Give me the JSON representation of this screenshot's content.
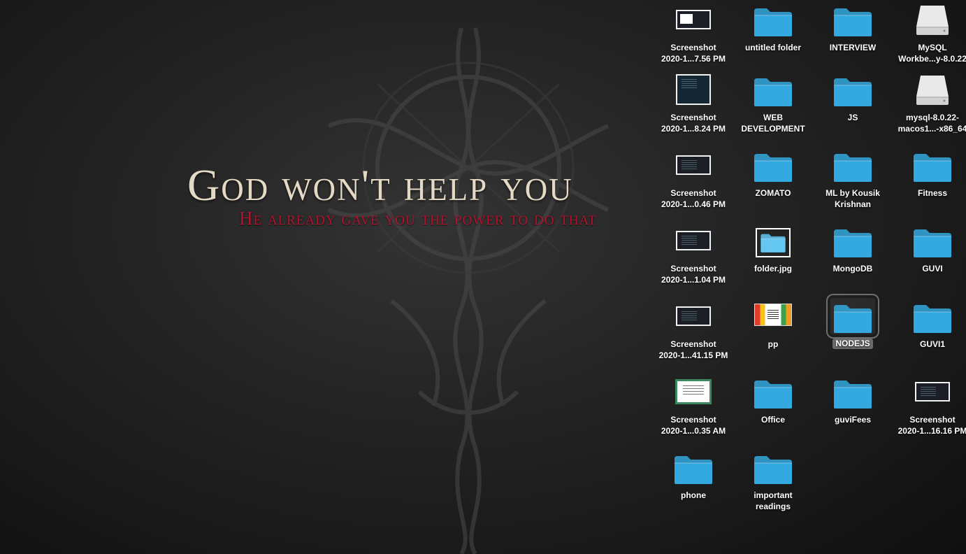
{
  "wallpaper": {
    "title": "God won't help you",
    "subtitle": "He already gave you the power to do that",
    "colors": {
      "title": "#e4d9c4",
      "subtitle": "#b3132e",
      "background": "#1e1e1e"
    }
  },
  "colors": {
    "folder": "#34a9e0",
    "folder_light": "#63c7f2",
    "selection": "#6b6b6b"
  },
  "icons": [
    {
      "name": "screenshot-1",
      "type": "screenshot",
      "variant": "white",
      "label": "Screenshot\n2020-1...7.56 PM"
    },
    {
      "name": "untitled-folder",
      "type": "folder",
      "label": "untitled folder"
    },
    {
      "name": "interview-folder",
      "type": "folder",
      "label": "INTERVIEW"
    },
    {
      "name": "mysql-workbench-disk",
      "type": "disk",
      "label": "MySQL\nWorkbe...y-8.0.22"
    },
    {
      "name": "screenshot-2",
      "type": "screenshot",
      "variant": "dark-blue",
      "label": "Screenshot\n2020-1...8.24 PM"
    },
    {
      "name": "web-development-folder",
      "type": "folder",
      "label": "WEB\nDEVELOPMENT"
    },
    {
      "name": "js-folder",
      "type": "folder",
      "label": "JS"
    },
    {
      "name": "mysql-disk",
      "type": "disk",
      "label": "mysql-8.0.22-\nmacos1...-x86_64"
    },
    {
      "name": "screenshot-3",
      "type": "screenshot",
      "variant": "dark",
      "label": "Screenshot\n2020-1...0.46 PM"
    },
    {
      "name": "zomato-folder",
      "type": "folder",
      "label": "ZOMATO"
    },
    {
      "name": "ml-by-kousik-krishnan-folder",
      "type": "folder",
      "label": "ML by Kousik\nKrishnan"
    },
    {
      "name": "fitness-folder",
      "type": "folder",
      "label": "Fitness"
    },
    {
      "name": "screenshot-4",
      "type": "screenshot",
      "variant": "dark",
      "label": "Screenshot\n2020-1...1.04 PM"
    },
    {
      "name": "folder-jpg",
      "type": "folder-image",
      "label": "folder.jpg"
    },
    {
      "name": "mongodb-folder",
      "type": "folder",
      "label": "MongoDB"
    },
    {
      "name": "guvi-folder",
      "type": "folder",
      "label": "GUVI"
    },
    {
      "name": "screenshot-5",
      "type": "screenshot",
      "variant": "dark",
      "label": "Screenshot\n2020-1...41.15 PM"
    },
    {
      "name": "pp-image",
      "type": "image-pp",
      "label": "pp"
    },
    {
      "name": "nodejs-folder",
      "type": "folder",
      "label": "NODEJS",
      "selected": true
    },
    {
      "name": "guvi1-folder",
      "type": "folder",
      "label": "GUVI1"
    },
    {
      "name": "screenshot-6",
      "type": "image-cert",
      "label": "Screenshot\n2020-1...0.35 AM"
    },
    {
      "name": "office-folder",
      "type": "folder",
      "label": "Office"
    },
    {
      "name": "guvifees-folder",
      "type": "folder",
      "label": "guviFees"
    },
    {
      "name": "screenshot-7",
      "type": "screenshot",
      "variant": "dark",
      "label": "Screenshot\n2020-1...16.16 PM"
    },
    {
      "name": "phone-folder",
      "type": "folder",
      "label": "phone"
    },
    {
      "name": "important-readings-folder",
      "type": "folder",
      "label": "important\nreadings"
    }
  ]
}
